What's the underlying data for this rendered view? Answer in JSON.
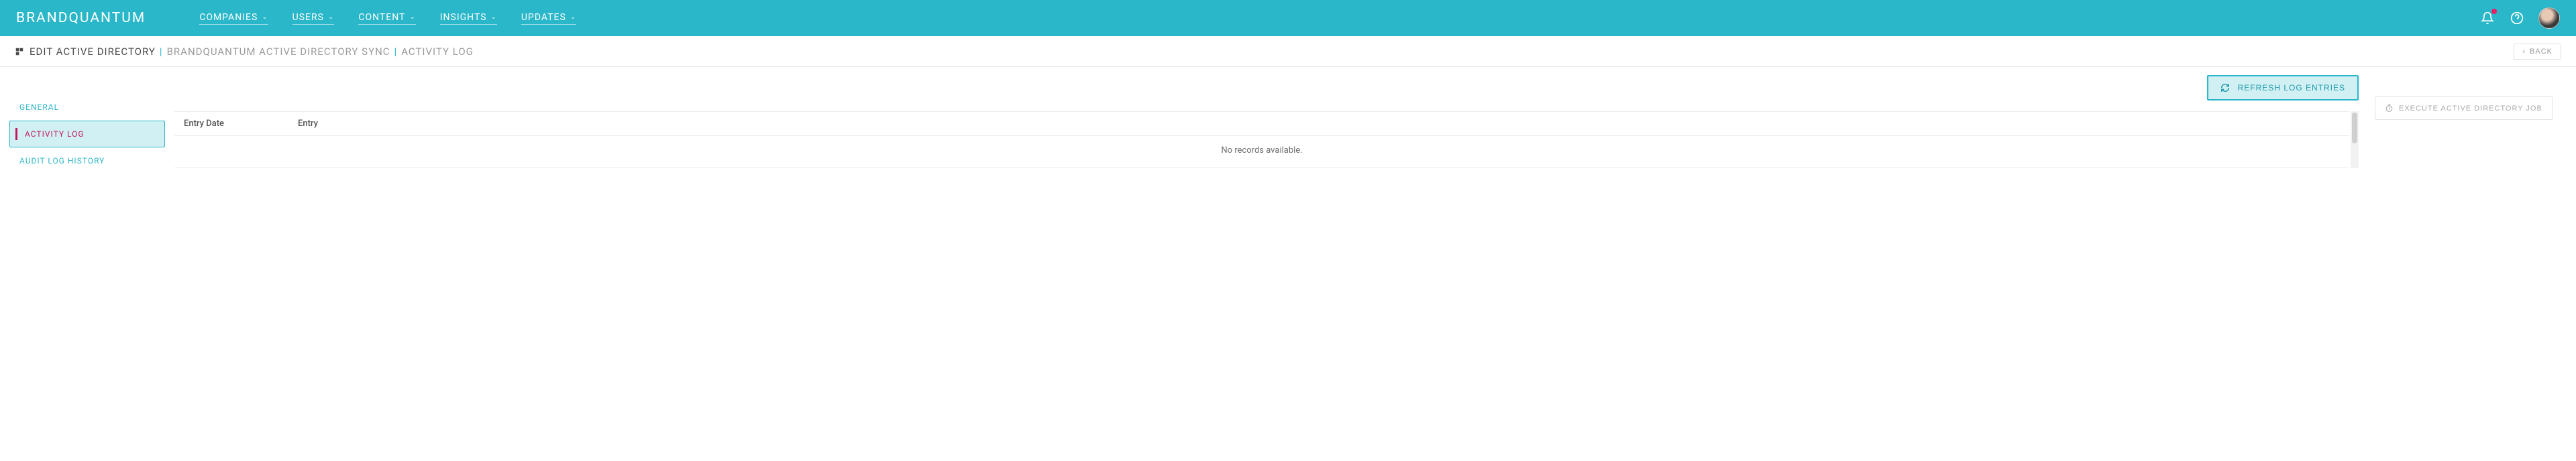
{
  "brand": "BRANDQUANTUM",
  "nav": {
    "items": [
      {
        "label": "COMPANIES"
      },
      {
        "label": "USERS"
      },
      {
        "label": "CONTENT"
      },
      {
        "label": "INSIGHTS"
      },
      {
        "label": "UPDATES"
      }
    ]
  },
  "breadcrumb": {
    "main": "EDIT ACTIVE DIRECTORY",
    "context": "BRANDQUANTUM ACTIVE DIRECTORY SYNC",
    "page": "ACTIVITY LOG"
  },
  "back_label": "BACK",
  "sidenav": {
    "items": [
      {
        "label": "GENERAL",
        "active": false
      },
      {
        "label": "ACTIVITY LOG",
        "active": true
      },
      {
        "label": "AUDIT LOG HISTORY",
        "active": false
      }
    ]
  },
  "actions": {
    "refresh": "REFRESH LOG ENTRIES",
    "execute": "EXECUTE ACTIVE DIRECTORY JOB"
  },
  "table": {
    "columns": [
      "Entry Date",
      "Entry"
    ],
    "rows": [],
    "empty": "No records available."
  }
}
